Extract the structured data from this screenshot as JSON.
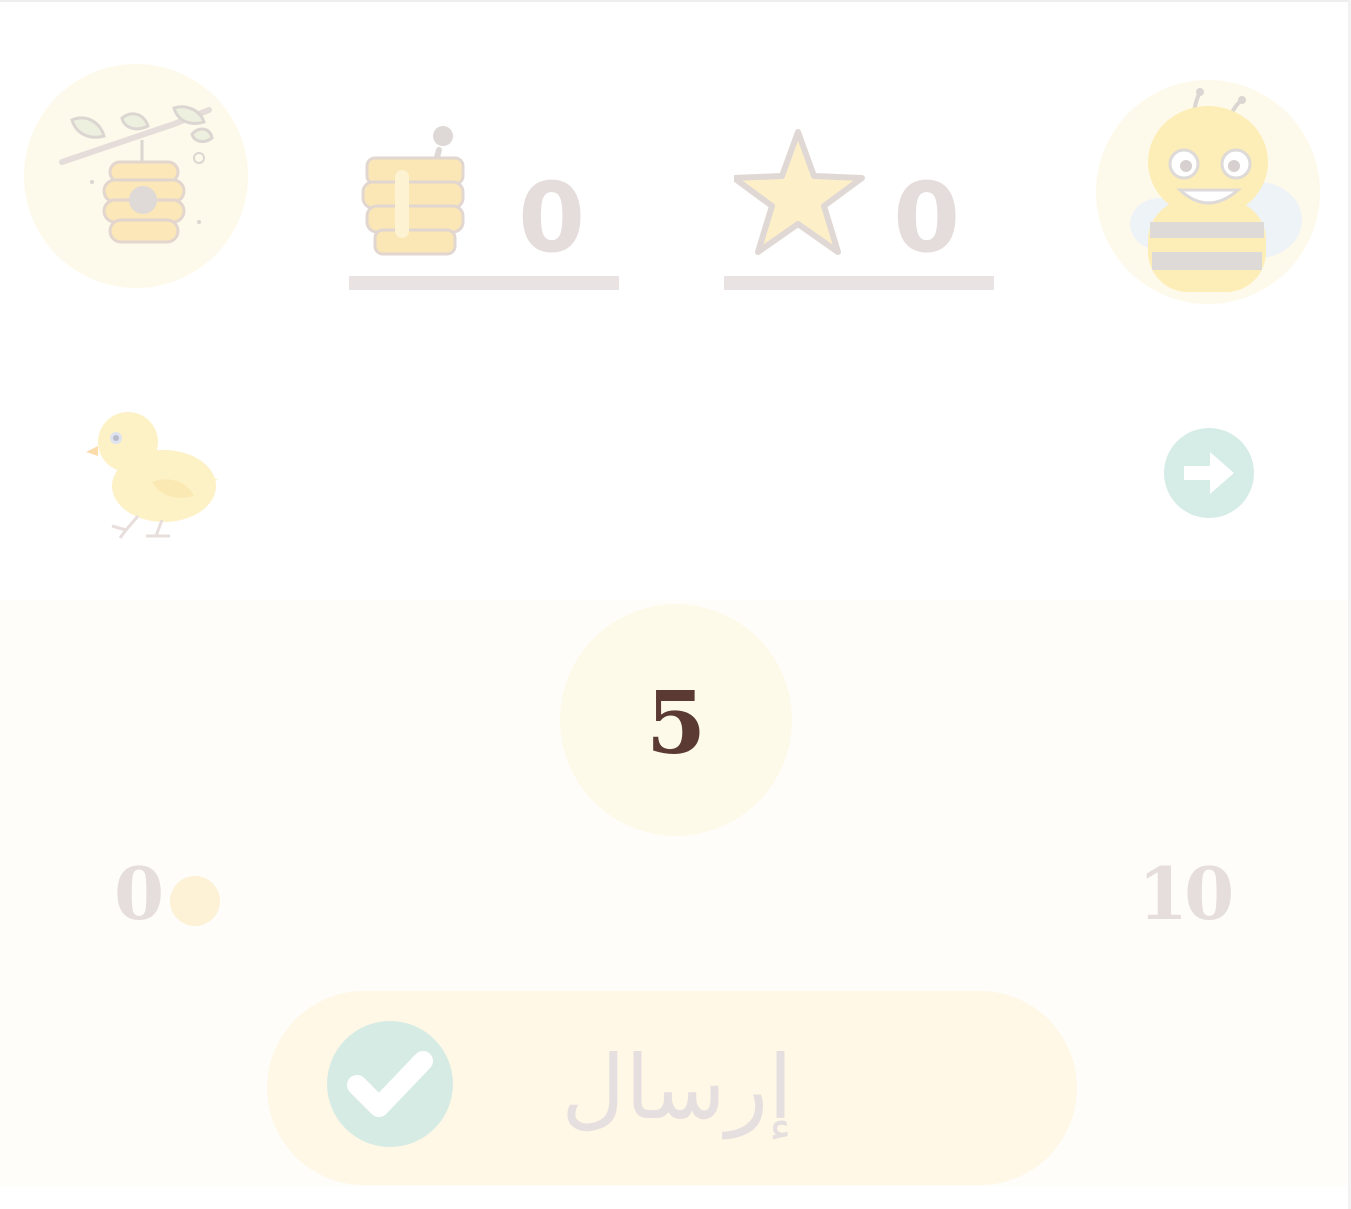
{
  "scoreboard": {
    "honey": {
      "icon": "honey-pot-icon",
      "value": "0"
    },
    "stars": {
      "icon": "star-icon",
      "value": "0"
    }
  },
  "avatars": {
    "left": "beehive-icon",
    "right": "bee-mascot-icon"
  },
  "navigation": {
    "mascot": "chick-icon",
    "next_icon": "arrow-right-circle-icon"
  },
  "slider": {
    "current_value": "5",
    "min_label": "0",
    "max_label": "10",
    "thumb_position": 0
  },
  "submit": {
    "label": "إرسال",
    "icon": "checkmark-icon"
  },
  "colors": {
    "background_panel": "#fffdfa",
    "bubble": "#fefaea",
    "value_text": "#5a3a33",
    "muted_text": "#e5dedd",
    "accent_teal": "#d6ece6",
    "accent_yellow": "#fff8e6"
  }
}
